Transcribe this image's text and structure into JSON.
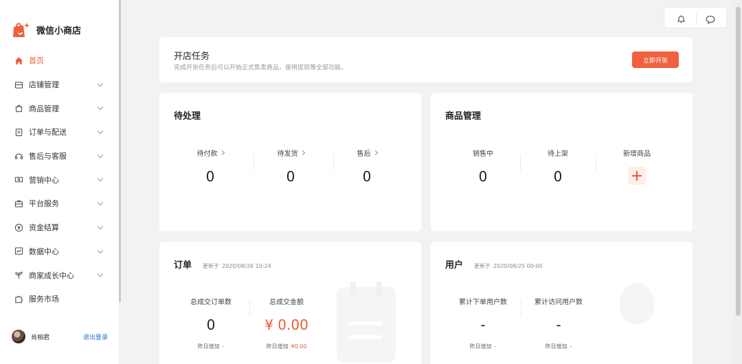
{
  "app": {
    "name": "微信小商店"
  },
  "sidebar": {
    "items": [
      {
        "label": "首页",
        "icon": "home-icon",
        "active": true,
        "expandable": false
      },
      {
        "label": "店铺管理",
        "icon": "store-icon",
        "active": false,
        "expandable": true
      },
      {
        "label": "商品管理",
        "icon": "bag-icon",
        "active": false,
        "expandable": true
      },
      {
        "label": "订单与配送",
        "icon": "clipboard-icon",
        "active": false,
        "expandable": true
      },
      {
        "label": "售后与客服",
        "icon": "headset-icon",
        "active": false,
        "expandable": true
      },
      {
        "label": "营销中心",
        "icon": "ticket-icon",
        "active": false,
        "expandable": true
      },
      {
        "label": "平台服务",
        "icon": "briefcase-icon",
        "active": false,
        "expandable": true
      },
      {
        "label": "资金结算",
        "icon": "yuan-icon",
        "active": false,
        "expandable": true
      },
      {
        "label": "数据中心",
        "icon": "chart-icon",
        "active": false,
        "expandable": true
      },
      {
        "label": "商家成长中心",
        "icon": "sprout-icon",
        "active": false,
        "expandable": true
      },
      {
        "label": "服务市场",
        "icon": "puzzle-icon",
        "active": false,
        "expandable": false
      }
    ],
    "user": {
      "name": "肖相君",
      "logout_label": "退出登录"
    }
  },
  "task": {
    "title": "开店任务",
    "subtitle": "完成开张任务后可以开始正式售卖商品，使用提现等全部功能。",
    "button_label": "立即开张"
  },
  "pending": {
    "title": "待处理",
    "stats": [
      {
        "label": "待付款",
        "value": "0"
      },
      {
        "label": "待发货",
        "value": "0"
      },
      {
        "label": "售后",
        "value": "0"
      }
    ]
  },
  "goods": {
    "title": "商品管理",
    "stats": [
      {
        "label": "销售中",
        "value": "0"
      },
      {
        "label": "待上架",
        "value": "0"
      }
    ],
    "add_label": "新增商品"
  },
  "orders": {
    "title": "订单",
    "updated_prefix": "更新于",
    "updated_time": "2020/08/26 10:24",
    "stats": [
      {
        "label": "总成交订单数",
        "value": "0",
        "yesterday_label": "昨日增加",
        "yesterday_value": "-"
      },
      {
        "label": "总成交金额",
        "value": "¥ 0.00",
        "yesterday_label": "昨日增加",
        "yesterday_value": "¥0.00"
      }
    ]
  },
  "users": {
    "title": "用户",
    "updated_prefix": "更新于",
    "updated_time": "2020/08/25 00:00",
    "stats": [
      {
        "label": "累计下单用户数",
        "value": "-",
        "yesterday_label": "昨日增加",
        "yesterday_value": "-"
      },
      {
        "label": "累计访问用户数",
        "value": "-",
        "yesterday_label": "昨日增加",
        "yesterday_value": "-"
      }
    ]
  },
  "colors": {
    "accent": "#ee5a36",
    "button": "#f0603f",
    "link": "#2b6fd6"
  }
}
